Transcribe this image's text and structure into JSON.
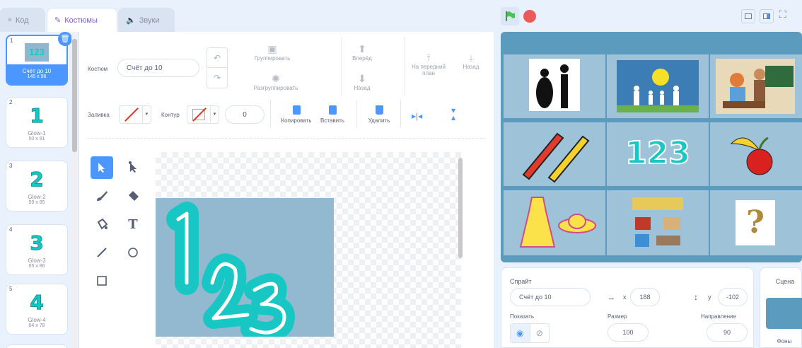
{
  "tabs": {
    "code": "Код",
    "costumes": "Костюмы",
    "sounds": "Звуки"
  },
  "costumes": [
    {
      "num": "1",
      "glyph": "123",
      "name": "Счёт до 10",
      "size": "145 x 96"
    },
    {
      "num": "2",
      "glyph": "1",
      "name": "Glow-1",
      "size": "50 x 81"
    },
    {
      "num": "3",
      "glyph": "2",
      "name": "Glow-2",
      "size": "59 x 85"
    },
    {
      "num": "4",
      "glyph": "3",
      "name": "Glow-3",
      "size": "65 x 86"
    },
    {
      "num": "5",
      "glyph": "4",
      "name": "Glow-4",
      "size": "64 x 78"
    }
  ],
  "editor": {
    "costume_label": "Костюм",
    "costume_name": "Счёт до 10",
    "group": "Группировать",
    "ungroup": "Разгруппировать",
    "forward": "Вперёд",
    "backward": "Назад",
    "front": "На передний план",
    "back": "Назад",
    "fill_label": "Заливка",
    "outline_label": "Контур",
    "outline_width": "0",
    "copy": "Копировать",
    "paste": "Вставить",
    "delete": "Удалить",
    "canvas_text": "123"
  },
  "sprite": {
    "label": "Спрайт",
    "name": "Счёт до 10",
    "x_label": "x",
    "x": "188",
    "y_label": "y",
    "y": "-102",
    "show_label": "Показать",
    "size_label": "Размер",
    "size": "100",
    "direction_label": "Направление",
    "direction": "90"
  },
  "stage_panel": {
    "title": "Сцена",
    "backdrops": "Фоны"
  },
  "colors": {
    "accent": "#855cd6",
    "selected": "#4c97ff",
    "teal": "#18c7c4",
    "stage_bg": "#5b9bbe"
  }
}
